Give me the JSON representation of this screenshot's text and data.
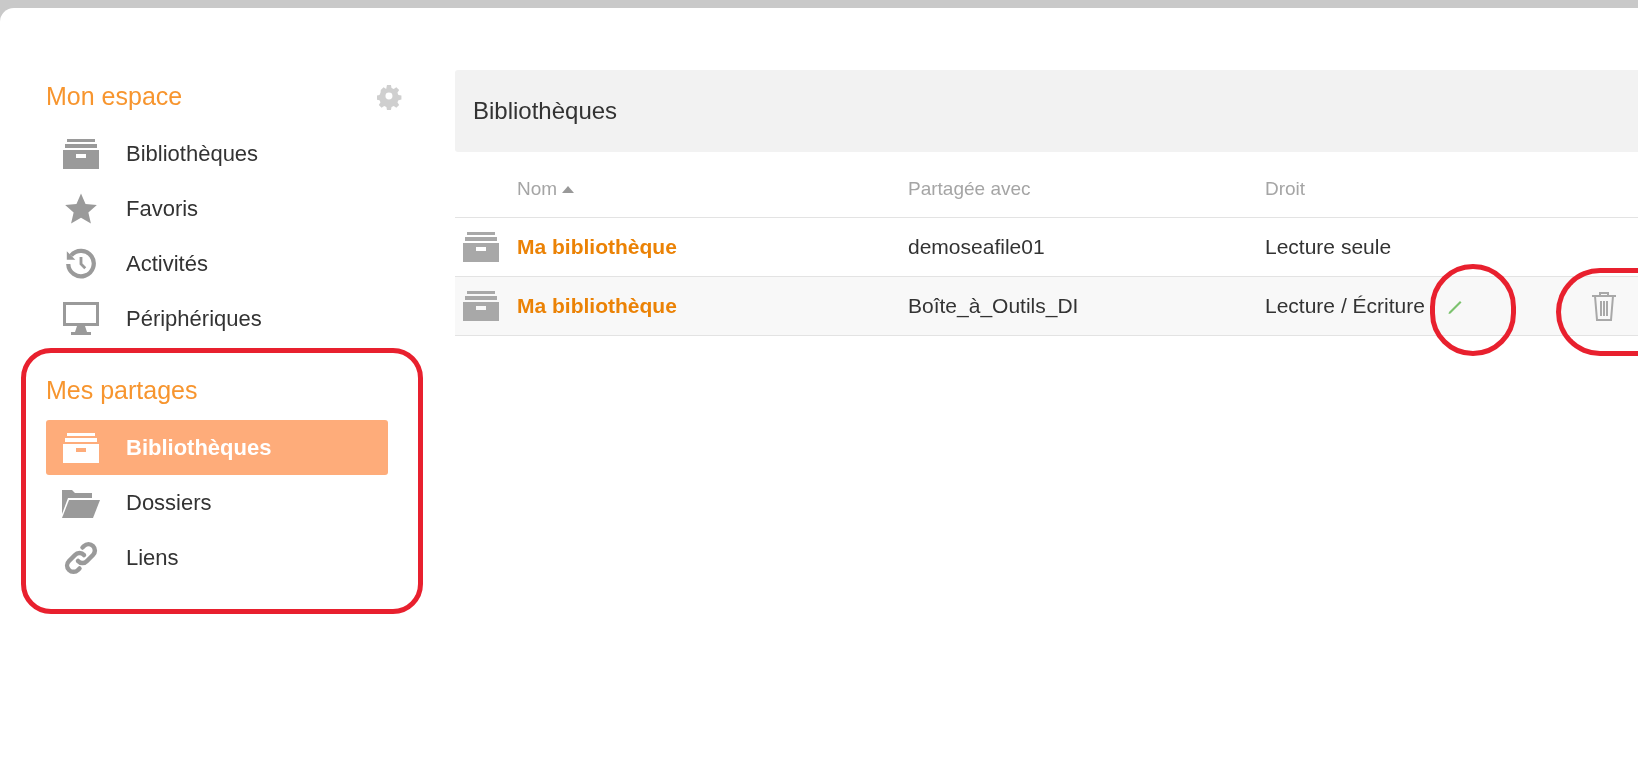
{
  "sidebar": {
    "sections": [
      {
        "title": "Mon espace",
        "settings": true,
        "annotated": false,
        "items": [
          {
            "kind": "library",
            "label": "Bibliothèques",
            "selected": false
          },
          {
            "kind": "star",
            "label": "Favoris",
            "selected": false
          },
          {
            "kind": "history",
            "label": "Activités",
            "selected": false
          },
          {
            "kind": "monitor",
            "label": "Périphériques",
            "selected": false
          }
        ]
      },
      {
        "title": "Mes partages",
        "settings": false,
        "annotated": true,
        "items": [
          {
            "kind": "library",
            "label": "Bibliothèques",
            "selected": true
          },
          {
            "kind": "folder",
            "label": "Dossiers",
            "selected": false
          },
          {
            "kind": "link",
            "label": "Liens",
            "selected": false
          }
        ]
      }
    ]
  },
  "panel": {
    "title": "Bibliothèques"
  },
  "table": {
    "columns": [
      {
        "label": "Nom",
        "sorted": true
      },
      {
        "label": "Partagée avec",
        "sorted": false
      },
      {
        "label": "Droit",
        "sorted": false
      }
    ],
    "rows": [
      {
        "name": "Ma bibliothèque",
        "shared_with": "demoseafile01",
        "permission": "Lecture seule",
        "hovered": false
      },
      {
        "name": "Ma bibliothèque",
        "shared_with": "Boîte_à_Outils_DI",
        "permission": "Lecture / Écriture",
        "hovered": true
      }
    ]
  }
}
